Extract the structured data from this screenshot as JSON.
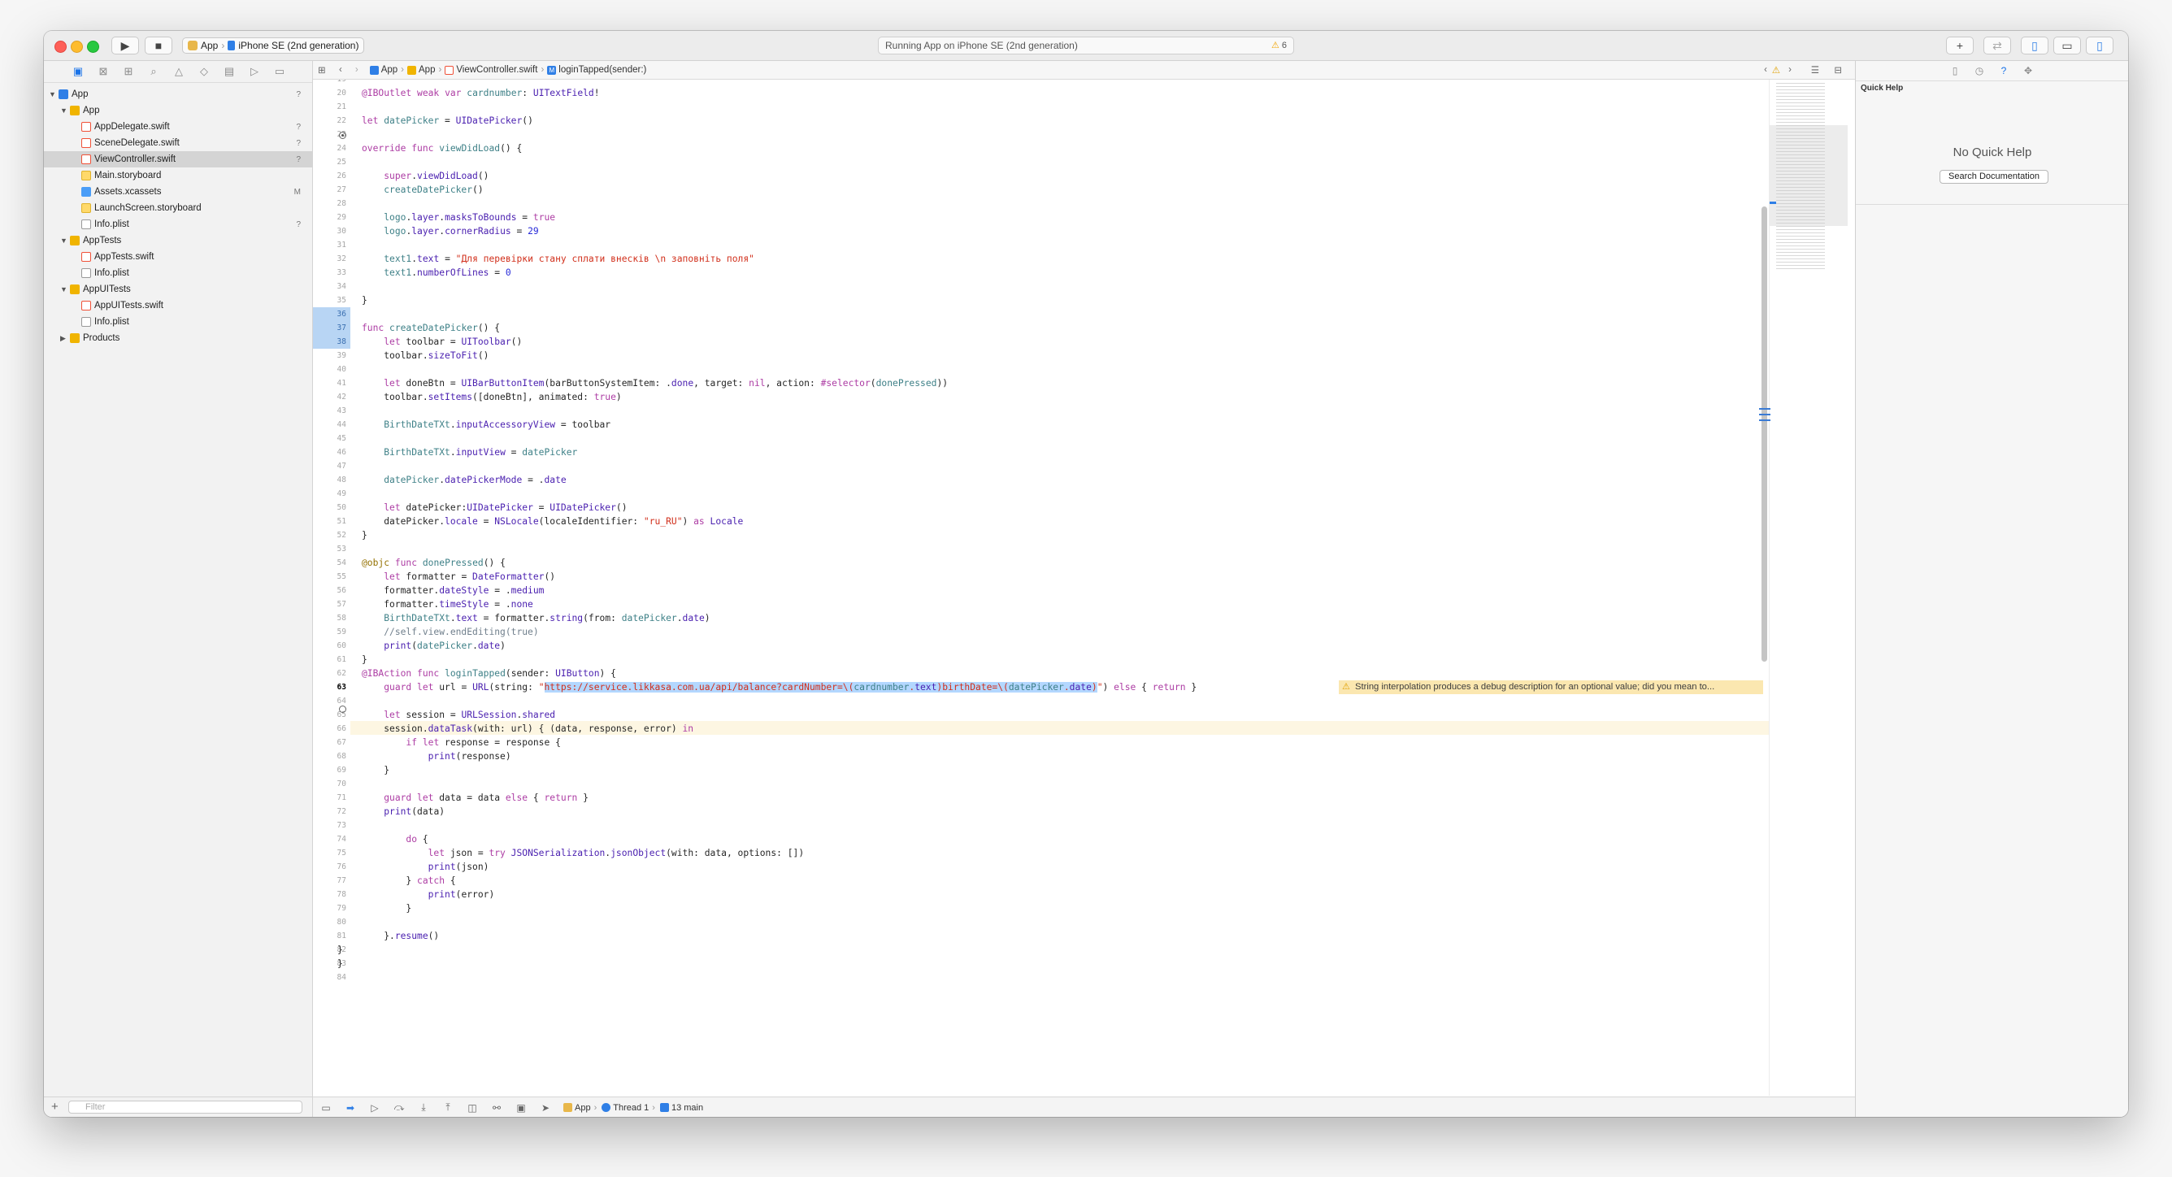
{
  "toolbar": {
    "scheme_app": "App",
    "scheme_device": "iPhone SE (2nd generation)",
    "status_text": "Running App on iPhone SE (2nd generation)",
    "warning_count": "6"
  },
  "navigator": {
    "filter_placeholder": "Filter",
    "items": [
      {
        "label": "App",
        "badge": "?"
      },
      {
        "label": "App",
        "badge": ""
      },
      {
        "label": "AppDelegate.swift",
        "badge": "?"
      },
      {
        "label": "SceneDelegate.swift",
        "badge": "?"
      },
      {
        "label": "ViewController.swift",
        "badge": "?"
      },
      {
        "label": "Main.storyboard",
        "badge": ""
      },
      {
        "label": "Assets.xcassets",
        "badge": "M"
      },
      {
        "label": "LaunchScreen.storyboard",
        "badge": ""
      },
      {
        "label": "Info.plist",
        "badge": "?"
      },
      {
        "label": "AppTests",
        "badge": ""
      },
      {
        "label": "AppTests.swift",
        "badge": ""
      },
      {
        "label": "Info.plist",
        "badge": ""
      },
      {
        "label": "AppUITests",
        "badge": ""
      },
      {
        "label": "AppUITests.swift",
        "badge": ""
      },
      {
        "label": "Info.plist",
        "badge": ""
      },
      {
        "label": "Products",
        "badge": ""
      }
    ]
  },
  "jumpbar": {
    "crumbs": [
      "App",
      "App",
      "ViewController.swift",
      "loginTapped(sender:)"
    ]
  },
  "editor": {
    "line_numbers": [
      "19",
      "20",
      "21",
      "22",
      "23",
      "24",
      "25",
      "26",
      "27",
      "28",
      "29",
      "30",
      "31",
      "32",
      "33",
      "34",
      "35",
      "36",
      "37",
      "38",
      "39",
      "40",
      "41",
      "42",
      "43",
      "44",
      "45",
      "46",
      "47",
      "48",
      "49",
      "50",
      "51",
      "52",
      "53",
      "54",
      "55",
      "56",
      "57",
      "58",
      "59",
      "60",
      "61",
      "62",
      "63",
      "64",
      "65",
      "66",
      "67",
      "68",
      "69",
      "70",
      "71",
      "72",
      "73",
      "74",
      "75",
      "76",
      "77",
      "78",
      "79",
      "80",
      "81",
      "82",
      "83",
      "84"
    ],
    "warning_message": "String interpolation produces a debug description for an optional value; did you mean to..."
  },
  "debugbar": {
    "crumbs": [
      "App",
      "Thread 1",
      "13 main"
    ]
  },
  "inspector": {
    "title": "Quick Help",
    "no_help": "No Quick Help",
    "search_button": "Search Documentation"
  },
  "colors": {
    "accent": "#2f7fe6",
    "breakpoint": "#b8d5f4",
    "warning": "#fbe7b0",
    "keyword": "#ad3da4",
    "string": "#d12f1b"
  }
}
